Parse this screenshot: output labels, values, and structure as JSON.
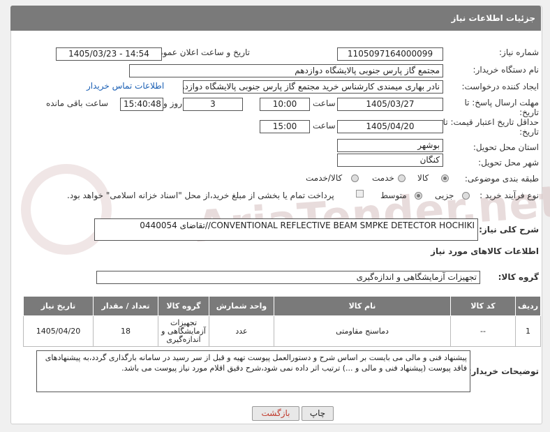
{
  "header": {
    "title": "جزئیات اطلاعات نیاز"
  },
  "fields": {
    "need_no_label": "شماره نیاز:",
    "need_no": "1105097164000099",
    "announce_label": "تاریخ و ساعت اعلان عمومی:",
    "announce_value": "1405/03/23 - 14:54",
    "buyer_label": "نام دستگاه خریدار:",
    "buyer_value": "مجتمع گاز پارس جنوبی  پالایشگاه دوازدهم",
    "creator_label": "ایجاد کننده درخواست:",
    "creator_value": "نادر بهاری میمندی کارشناس خرید مجتمع گاز پارس جنوبی  پالایشگاه دوازدهم",
    "contact_link": "اطلاعات تماس خریدار",
    "deadline_label": "مهلت ارسال پاسخ: تا تاریخ:",
    "deadline_date": "1405/03/27",
    "time_label": "ساعت",
    "deadline_time": "10:00",
    "days_value": "3",
    "days_label": "روز و",
    "remaining_time": "15:40:48",
    "remaining_label": "ساعت باقی مانده",
    "validity_label": "حداقل تاریخ اعتبار قیمت: تا تاریخ:",
    "validity_date": "1405/04/20",
    "validity_time": "15:00",
    "province_label": "استان محل تحویل:",
    "province_value": "بوشهر",
    "city_label": "شهر محل تحویل:",
    "city_value": "کنگان",
    "category_label": "طبقه بندی موضوعی:",
    "category_options": [
      "کالا",
      "خدمت",
      "کالا/خدمت"
    ],
    "process_label": "نوع فرآیند خرید :",
    "process_options": [
      "جزیی",
      "متوسط"
    ],
    "payment_note": "پرداخت تمام یا بخشی از مبلغ خرید،از محل \"اسناد خزانه اسلامی\" خواهد بود."
  },
  "description": {
    "label": "شرح کلی نیاز:",
    "value": "0440054 تقاضای//CONVENTIONAL REFLECTIVE BEAM SMPKE DETECTOR HOCHIKI"
  },
  "goods_section": {
    "title": "اطلاعات کالاهای مورد نیاز",
    "group_label": "گروه کالا:",
    "group_value": "تجهیزات آزمایشگاهی و اندازه‌گیری"
  },
  "table": {
    "headers": [
      "ردیف",
      "کد کالا",
      "نام کالا",
      "واحد شمارش",
      "گروه کالا",
      "تعداد / مقدار",
      "تاریخ نیاز"
    ],
    "rows": [
      {
        "row": "1",
        "code": "--",
        "name": "دماسنج مقاومتی",
        "unit": "عدد",
        "group": "تجهیزات آزمایشگاهی و اندازه‌گیری",
        "qty": "18",
        "date": "1405/04/20"
      }
    ]
  },
  "buyer_notes": {
    "label": "توضیحات خریدار:",
    "value": "پیشنهاد فنی و مالی می بایست بر اساس شرح و دستورالعمل پیوست تهیه و قبل از سر رسید در سامانه بارگذاری گردد،به پیشنهادهای فاقد پیوست (پیشنهاد فنی و مالی و ...) ترتیب اثر داده نمی شود،شرح دقیق اقلام مورد نیاز پیوست می باشد."
  },
  "buttons": {
    "back": "بازگشت",
    "print": "چاپ"
  },
  "watermark": "AriaTender.net",
  "colors": {
    "header_bg": "#7a7a7a",
    "link": "#1a5fb4",
    "back_btn": "#c0392b"
  }
}
